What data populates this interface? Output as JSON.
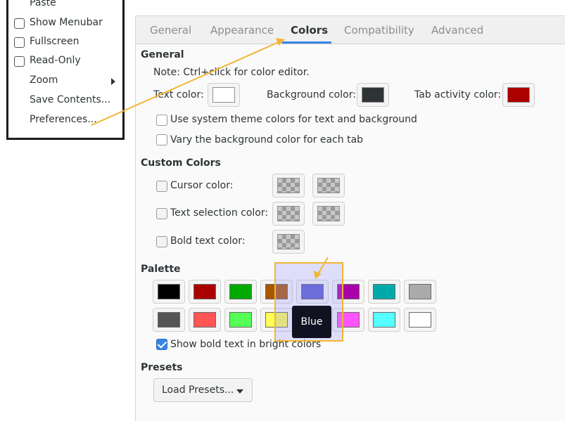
{
  "menu": {
    "items": [
      {
        "label": "Paste",
        "has_check": false,
        "submenu": false
      },
      {
        "label": "Show Menubar",
        "has_check": true,
        "submenu": false
      },
      {
        "label": "Fullscreen",
        "has_check": true,
        "submenu": false
      },
      {
        "label": "Read-Only",
        "has_check": true,
        "submenu": false
      },
      {
        "label": "Zoom",
        "has_check": false,
        "submenu": true
      },
      {
        "label": "Save Contents...",
        "has_check": false,
        "submenu": false
      },
      {
        "label": "Preferences...",
        "has_check": false,
        "submenu": false
      }
    ]
  },
  "tabs": [
    "General",
    "Appearance",
    "Colors",
    "Compatibility",
    "Advanced"
  ],
  "active_tab": "Colors",
  "general": {
    "heading": "General",
    "note": "Note: Ctrl+click for color editor.",
    "text_color_label": "Text color:",
    "text_color": "#ffffff",
    "bg_color_label": "Background color:",
    "bg_color": "#2e3436",
    "tab_activity_label": "Tab activity color:",
    "tab_activity_color": "#aa0000",
    "use_system_label": "Use system theme colors for text and background",
    "vary_bg_label": "Vary the background color for each tab"
  },
  "custom": {
    "heading": "Custom Colors",
    "cursor_label": "Cursor color:",
    "selection_label": "Text selection color:",
    "bold_label": "Bold text color:"
  },
  "palette": {
    "heading": "Palette",
    "row1": [
      "#000000",
      "#aa0000",
      "#00aa00",
      "#aa5500",
      "#5c5ccc",
      "#aa00aa",
      "#00aaaa",
      "#aaaaaa"
    ],
    "row2": [
      "#555555",
      "#ff5555",
      "#55ff55",
      "#ffff55",
      "#5555ff",
      "#ff55ff",
      "#55ffff",
      "#ffffff"
    ],
    "bright_label": "Show bold text in bright colors",
    "bright_checked": true,
    "tooltip": "Blue"
  },
  "presets": {
    "heading": "Presets",
    "button_label": "Load Presets..."
  },
  "colors": {
    "highlight_border": "#f2b632",
    "accent": "#3584e4"
  }
}
